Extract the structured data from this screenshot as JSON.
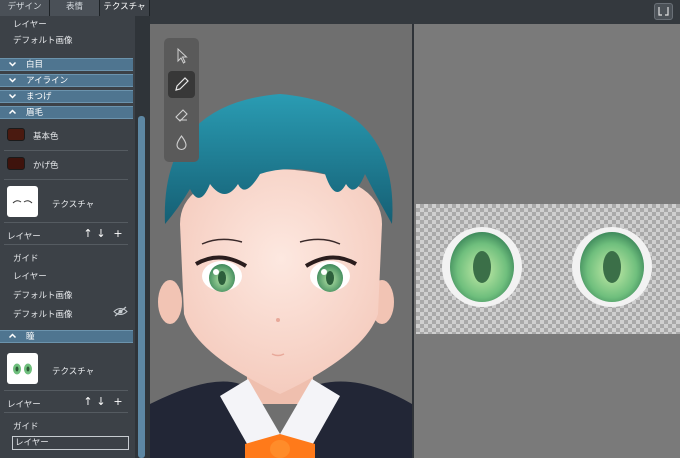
{
  "tabs": [
    "デザイン",
    "表情",
    "テクスチャ"
  ],
  "top_items": [
    "レイヤー",
    "デフォルト画像"
  ],
  "sections": {
    "white_eye": "白目",
    "eyeline": "アイライン",
    "eyelash": "まつげ",
    "eyebrow": "眉毛",
    "pupil": "瞳"
  },
  "eyebrow": {
    "base_color_label": "基本色",
    "base_color": "#4a1a10",
    "shadow_color_label": "かげ色",
    "shadow_color": "#3e130c",
    "texture_label": "テクスチャ",
    "layer_label": "レイヤー",
    "layers": [
      "ガイド",
      "レイヤー",
      "デフォルト画像",
      "デフォルト画像"
    ]
  },
  "pupil": {
    "texture_label": "テクスチャ",
    "layer_label": "レイヤー",
    "layers": [
      "ガイド",
      "レイヤー"
    ]
  },
  "icons": {
    "move_up": "↑",
    "move_down": "↓",
    "add": "+",
    "expand": "⌄",
    "collapse": "⌃"
  },
  "tools": [
    "select-arrow",
    "pencil",
    "eraser",
    "fill-drop"
  ],
  "colors": {
    "section_header": "#4f7590",
    "hair": "#1f7f95",
    "iris": "#7ec98a",
    "tie": "#ff7a1a"
  }
}
